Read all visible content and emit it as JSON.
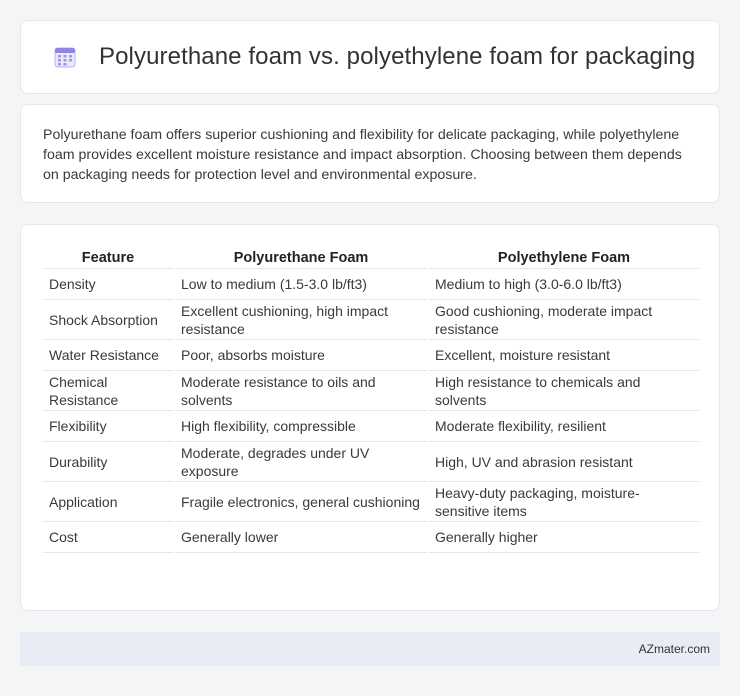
{
  "header": {
    "title": "Polyurethane foam vs. polyethylene foam for packaging",
    "icon": "calendar-grid-icon",
    "icon_color": "#7b6fd6"
  },
  "summary": {
    "text": "Polyurethane foam offers superior cushioning and flexibility for delicate packaging, while polyethylene foam provides excellent moisture resistance and impact absorption. Choosing between them depends on packaging needs for protection level and environmental exposure."
  },
  "table": {
    "headers": [
      "Feature",
      "Polyurethane Foam",
      "Polyethylene Foam"
    ],
    "rows": [
      {
        "feature": "Density",
        "pu": "Low to medium (1.5-3.0 lb/ft3)",
        "pe": "Medium to high (3.0-6.0 lb/ft3)"
      },
      {
        "feature": "Shock Absorption",
        "pu": "Excellent cushioning, high impact resistance",
        "pe": "Good cushioning, moderate impact resistance"
      },
      {
        "feature": "Water Resistance",
        "pu": "Poor, absorbs moisture",
        "pe": "Excellent, moisture resistant"
      },
      {
        "feature": "Chemical Resistance",
        "pu": "Moderate resistance to oils and solvents",
        "pe": "High resistance to chemicals and solvents"
      },
      {
        "feature": "Flexibility",
        "pu": "High flexibility, compressible",
        "pe": "Moderate flexibility, resilient"
      },
      {
        "feature": "Durability",
        "pu": "Moderate, degrades under UV exposure",
        "pe": "High, UV and abrasion resistant"
      },
      {
        "feature": "Application",
        "pu": "Fragile electronics, general cushioning",
        "pe": "Heavy-duty packaging, moisture-sensitive items"
      },
      {
        "feature": "Cost",
        "pu": "Generally lower",
        "pe": "Generally higher"
      }
    ]
  },
  "footer": {
    "brand": "AZmater.com"
  }
}
